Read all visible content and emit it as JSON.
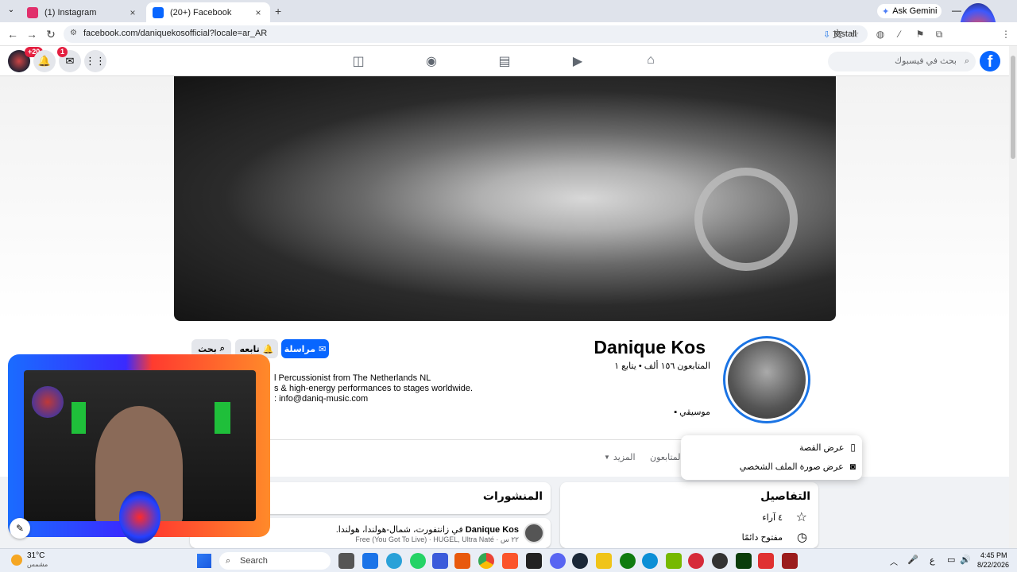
{
  "browser": {
    "tabs": [
      {
        "title": "(1) Instagram",
        "favicon_color": "#e1306c"
      },
      {
        "title": "(20+) Facebook",
        "favicon_color": "#0866ff"
      }
    ],
    "new_tab_label": "+",
    "url": "facebook.com/daniquekosofficial?locale=ar_AR",
    "install_label": "Install",
    "ask_gemini_label": "Ask Gemini"
  },
  "fb": {
    "search_placeholder": "بحث في فيسبوك",
    "logo_letter": "f",
    "notif_badge": "+20",
    "messenger_badge": "1"
  },
  "profile": {
    "name": "Danique Kos",
    "stats": "المتابعون ١٥٦ ألف • يتابع ١",
    "category": "موسيقي",
    "bio_lines": [
      "l Percussionist from The Netherlands NL",
      "s & high-energy performances to stages worldwide.",
      ": info@daniq-music.com"
    ],
    "message_button": "مراسلة",
    "follow_button": "تابعه",
    "search_button": "بحث",
    "tabs_more": "المزيد",
    "tabs_followers": "المتابعون"
  },
  "avatar_menu": {
    "items": [
      "عرض القصة",
      "عرض صورة الملف الشخصي"
    ]
  },
  "details": {
    "title": "التفاصيل",
    "reviews": "٤ آراء",
    "hours": "مفتوح دائمًا"
  },
  "posts": {
    "title": "المنشورات",
    "post_author": "Danique Kos",
    "post_location": "في زانتفورت، شمال-هولندا، هولندا.",
    "post_meta": "٢٢ س · Free (You Got To Live) · HUGEL, Ultra Naté",
    "more_dots": "•••"
  },
  "taskbar": {
    "weather_temp": "31°C",
    "weather_desc": "مشمس",
    "search_label": "Search",
    "time": "4:45 PM",
    "date": "8/22/2026",
    "lang": "ع"
  },
  "colors": {
    "fb_blue": "#0866ff",
    "badge_red": "#e41e3f",
    "avatar_ring": "#1b74e4"
  }
}
